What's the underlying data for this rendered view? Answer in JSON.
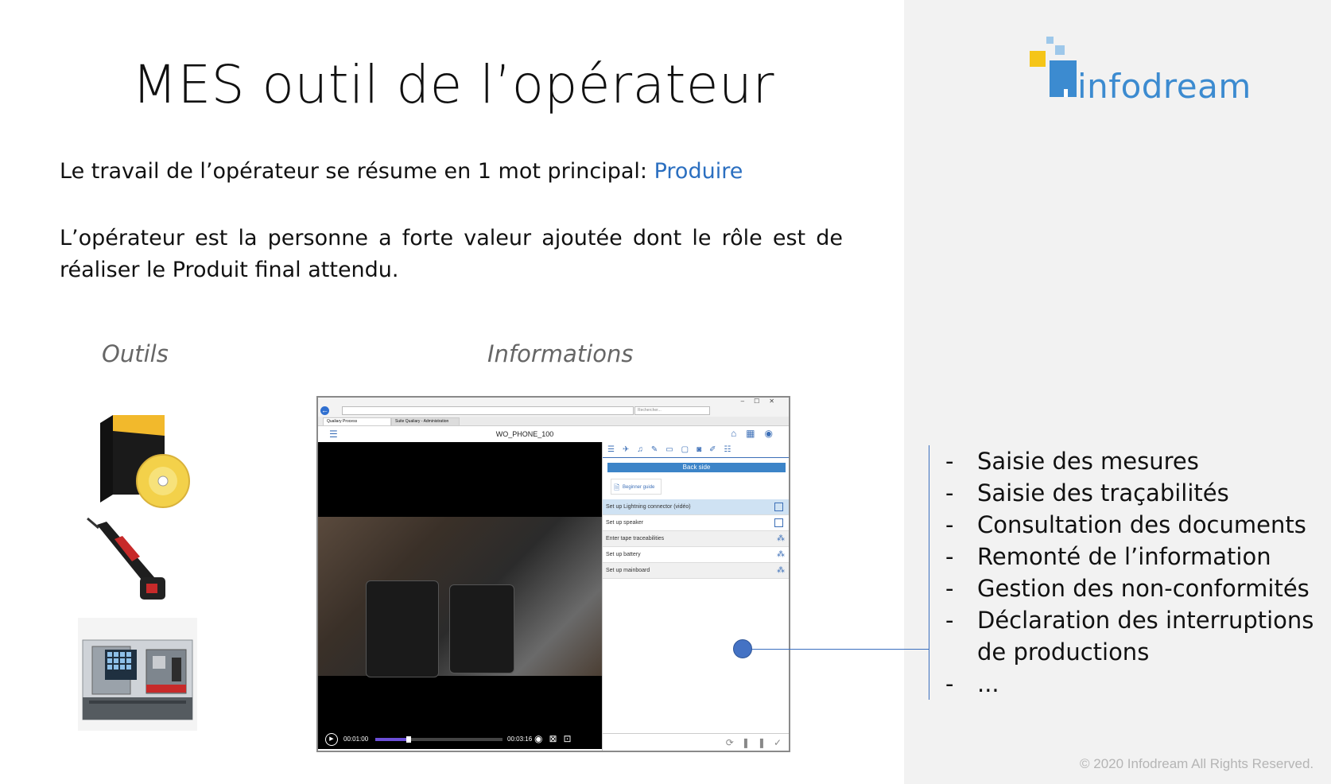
{
  "slide": {
    "title": "MES outil de l’opérateur",
    "intro_prefix": "Le travail de l’opérateur se résume en 1 mot principal: ",
    "intro_highlight": "Produire",
    "paragraph": "L’opérateur est la personne a forte valeur ajoutée dont le rôle est de réaliser le Produit final attendu.",
    "label_tools": "Outils",
    "label_info": "Informations",
    "copyright": "© 2020 Infodream All Rights Reserved."
  },
  "logo": {
    "name": "infodream",
    "colors": {
      "blue": "#3c8bd0",
      "yellow": "#f5c518",
      "light_blue": "#9ec8ea"
    }
  },
  "bullets": [
    "Saisie des mesures",
    "Saisie des traçabilités",
    "Consultation des documents",
    "Remonté de l’information",
    "Gestion des non-conformités",
    "Déclaration des interruptions de productions",
    "..."
  ],
  "bullet_dash": "-",
  "app": {
    "browser_searchbox": "Rechercher...",
    "tab_1": "Qualiary Process",
    "tab_2": "Suite Qualiary - Administration",
    "window_controls": "–☐✕",
    "hamburger": "☰",
    "work_order": "WO_PHONE_100",
    "header_icons": "⌂▦◉",
    "panel_tab_icons": "☰✈♫✎▭▢◙✐☷",
    "back_side_button": "Back side",
    "guide_icon": "🗎",
    "guide_button": "Beginner guide",
    "steps": [
      {
        "label": "Set up Lightning connector (vidéo)",
        "state": "active",
        "icon": "checkbox"
      },
      {
        "label": "Set up speaker",
        "state": "normal",
        "icon": "checkbox"
      },
      {
        "label": "Enter tape traceabilities",
        "state": "alt",
        "icon": "footsteps"
      },
      {
        "label": "Set up battery",
        "state": "normal",
        "icon": "footsteps"
      },
      {
        "label": "Set up mainboard",
        "state": "alt",
        "icon": "footsteps"
      }
    ],
    "footsteps_glyph": "⁂",
    "footer_icons": "⟳❚❚✓",
    "video": {
      "play_glyph": "▶",
      "current_time": "00:01:00",
      "total_time": "00:03:16",
      "progress": 0.26,
      "control_icons": "◉⊠⊡"
    }
  },
  "colors": {
    "accent": "#2b6fc0",
    "panel_bg": "#f2f2f2",
    "connector": "#4472c4"
  }
}
